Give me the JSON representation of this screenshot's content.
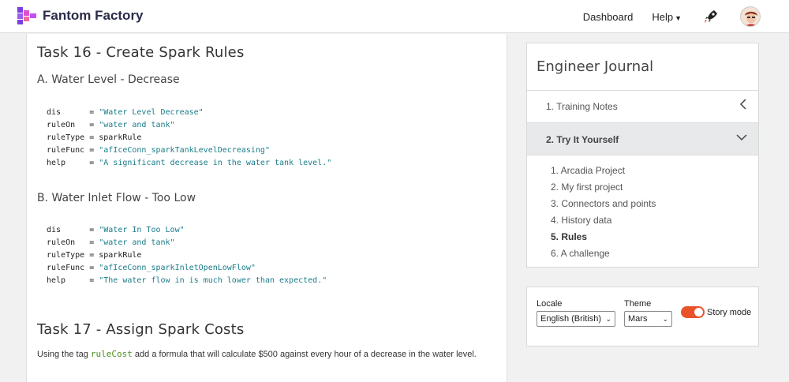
{
  "header": {
    "brand": "Fantom Factory",
    "nav": {
      "dashboard": "Dashboard",
      "help": "Help"
    }
  },
  "content": {
    "task16_title": "Task 16 - Create Spark Rules",
    "sectionA_title": "A. Water Level - Decrease",
    "sectionA_code": [
      {
        "key": "dis",
        "value": "\"Water Level Decrease\"",
        "is_string": true
      },
      {
        "key": "ruleOn",
        "value": "\"water and tank\"",
        "is_string": true
      },
      {
        "key": "ruleType",
        "value": "sparkRule",
        "is_string": false
      },
      {
        "key": "ruleFunc",
        "value": "\"afIceConn_sparkTankLevelDecreasing\"",
        "is_string": true
      },
      {
        "key": "help",
        "value": "\"A significant decrease in the water tank level.\"",
        "is_string": true
      }
    ],
    "sectionB_title": "B. Water Inlet Flow - Too Low",
    "sectionB_code": [
      {
        "key": "dis",
        "value": "\"Water In Too Low\"",
        "is_string": true
      },
      {
        "key": "ruleOn",
        "value": "\"water and tank\"",
        "is_string": true
      },
      {
        "key": "ruleType",
        "value": "sparkRule",
        "is_string": false
      },
      {
        "key": "ruleFunc",
        "value": "\"afIceConn_sparkInletOpenLowFlow\"",
        "is_string": true
      },
      {
        "key": "help",
        "value": "\"The water flow in is much lower than expected.\"",
        "is_string": true
      }
    ],
    "task17_title": "Task 17 - Assign Spark Costs",
    "task17_text_before": "Using the tag ",
    "task17_code": "ruleCost",
    "task17_text_after": " add a formula that will calculate $500 against every hour of a decrease in the water level."
  },
  "journal": {
    "title": "Engineer Journal",
    "section1": "1. Training Notes",
    "section2": "2. Try It Yourself",
    "items": [
      {
        "label": "1. Arcadia Project",
        "active": false
      },
      {
        "label": "2. My first project",
        "active": false
      },
      {
        "label": "3. Connectors and points",
        "active": false
      },
      {
        "label": "4. History data",
        "active": false
      },
      {
        "label": "5. Rules",
        "active": true
      },
      {
        "label": "6. A challenge",
        "active": false
      }
    ]
  },
  "settings": {
    "locale_label": "Locale",
    "locale_value": "English (British)",
    "theme_label": "Theme",
    "theme_value": "Mars",
    "story_mode_label": "Story mode",
    "story_mode_on": true
  },
  "colors": {
    "accent": "#e8532a",
    "code_string": "#1a7c89",
    "inline_code": "#4a8f20"
  }
}
